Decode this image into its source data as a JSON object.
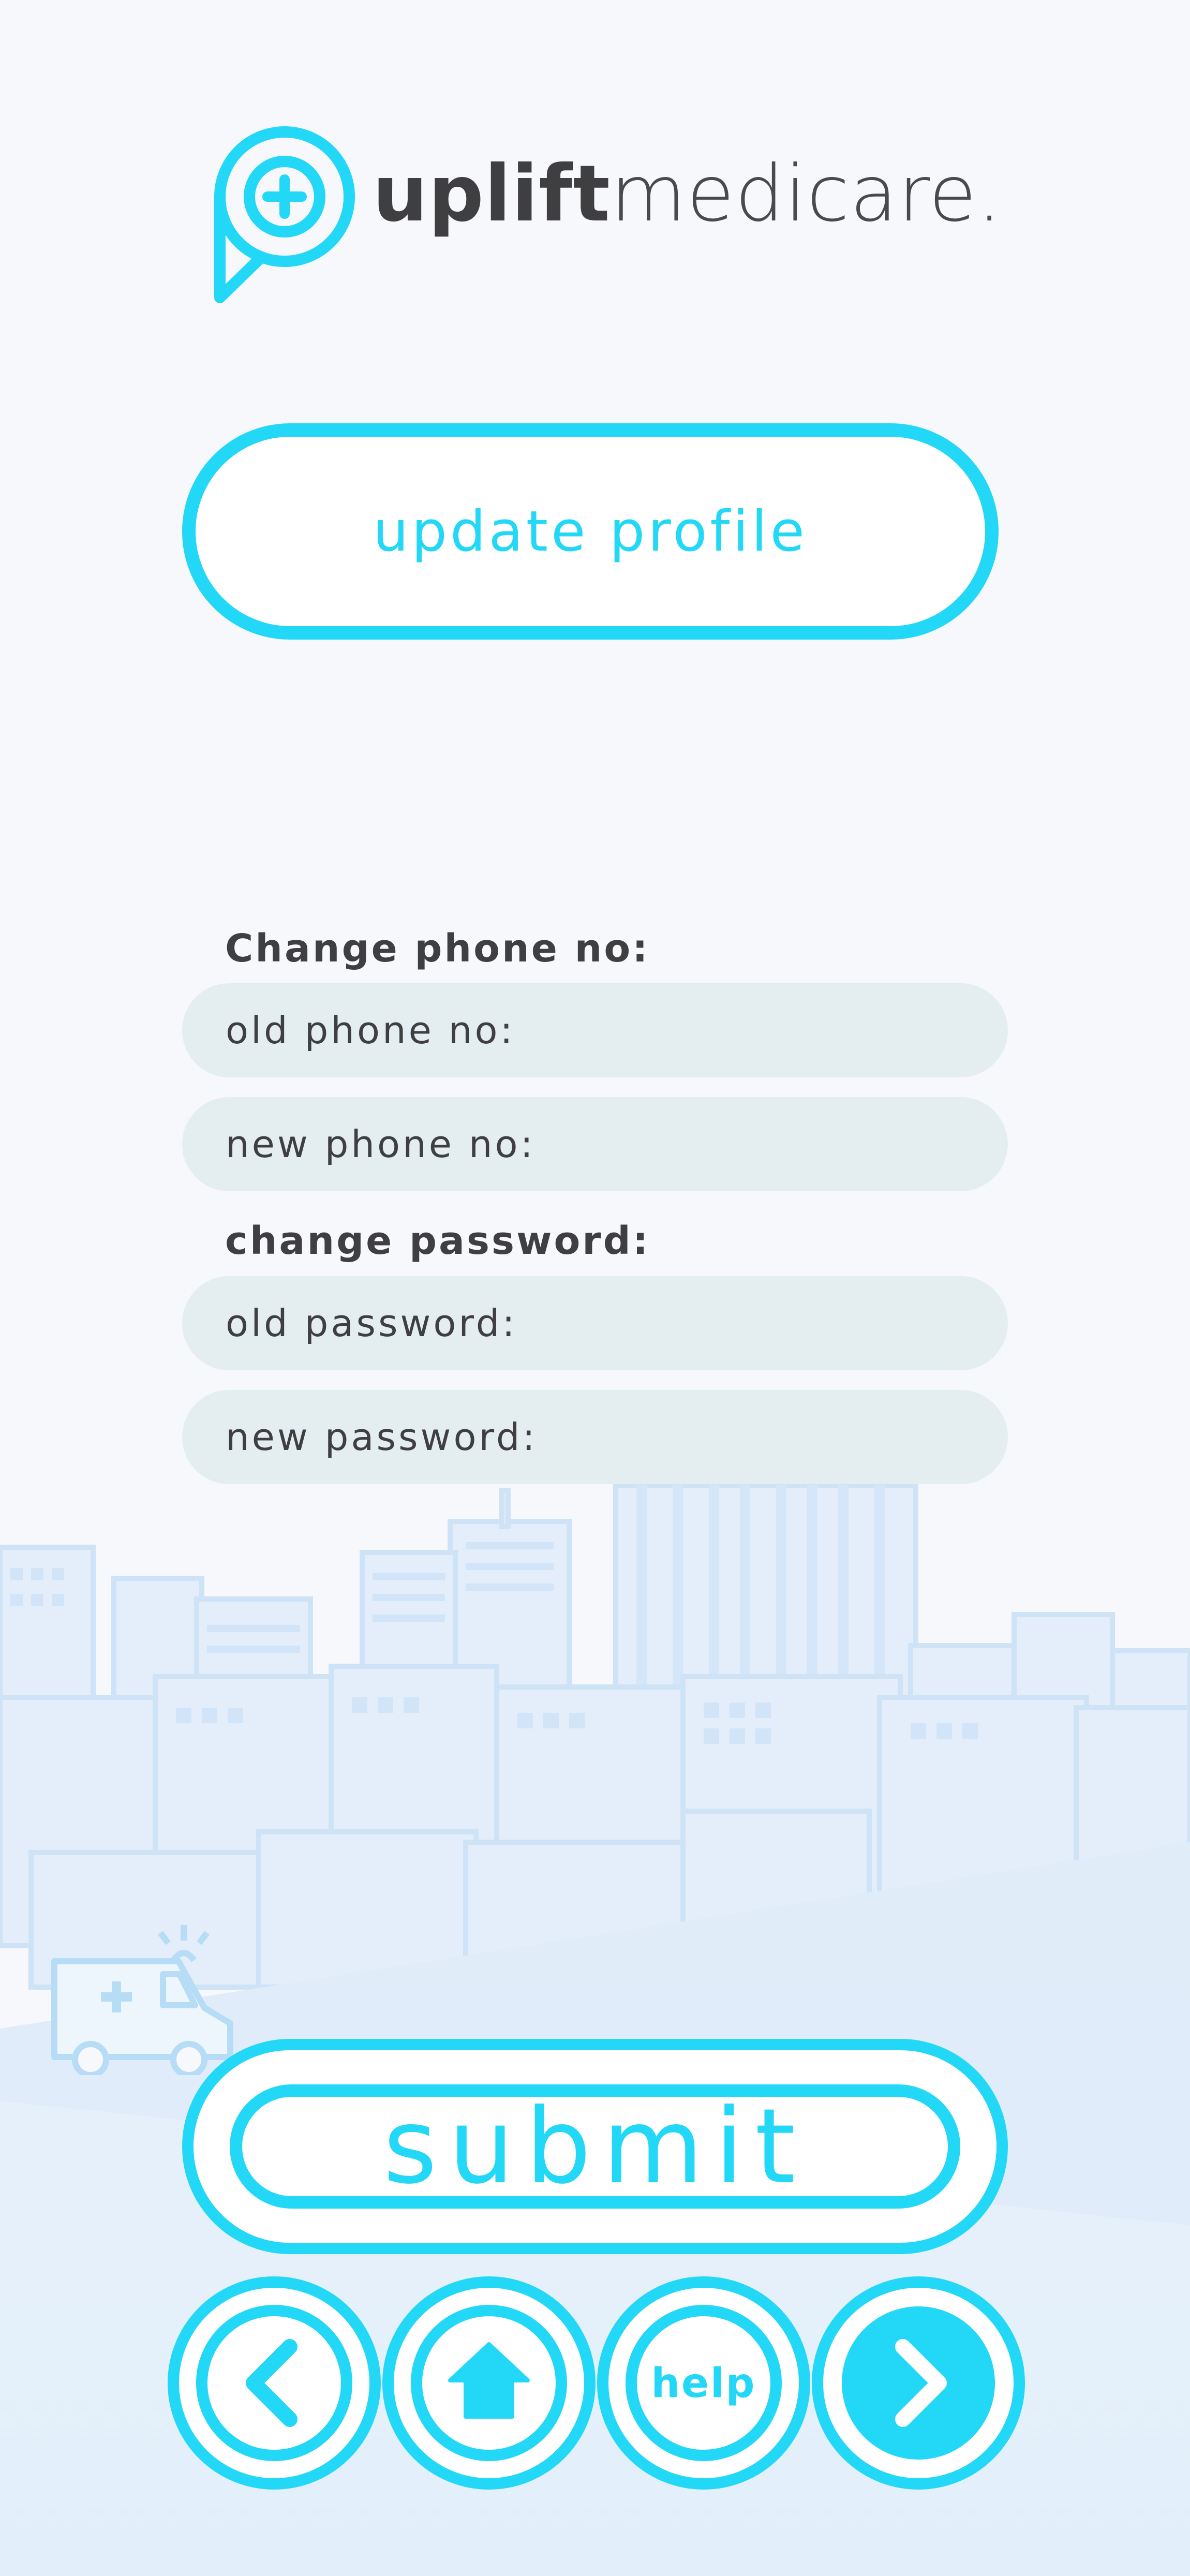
{
  "brand": {
    "name_bold": "uplift",
    "name_light": "medicare.",
    "accent_color": "#23d8f7",
    "text_color": "#3f3f41",
    "logo_icon": "plus-speech-bubble-icon"
  },
  "header": {
    "title": "update profile"
  },
  "form": {
    "phone_section_label": "Change phone no:",
    "old_phone_placeholder": "old phone no:",
    "new_phone_placeholder": "new phone no:",
    "password_section_label": "change password:",
    "old_password_placeholder": "old password:",
    "new_password_placeholder": "new password:"
  },
  "actions": {
    "submit_label": "submit"
  },
  "nav": {
    "back_icon": "chevron-left-icon",
    "home_icon": "home-up-arrow-icon",
    "help_label": "help",
    "next_icon": "chevron-right-icon"
  },
  "illustration": {
    "background": "city-skyline",
    "vehicle": "ambulance-icon"
  }
}
